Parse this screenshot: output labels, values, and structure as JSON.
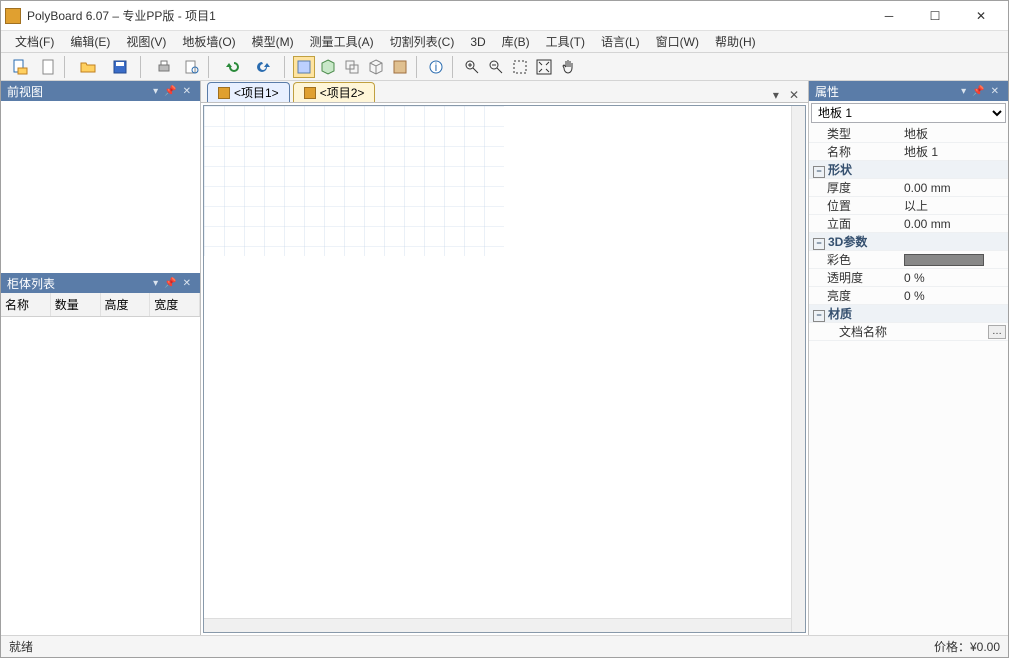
{
  "window": {
    "title": "PolyBoard 6.07 – 专业PP版 - 项目1"
  },
  "menu": {
    "file": "文档(F)",
    "edit": "编辑(E)",
    "view": "视图(V)",
    "floor": "地板墙(O)",
    "model": "模型(M)",
    "meas": "测量工具(A)",
    "cut": "切割列表(C)",
    "threeD": "3D",
    "lib": "库(B)",
    "tool": "工具(T)",
    "lang": "语言(L)",
    "win": "窗口(W)",
    "help": "帮助(H)"
  },
  "panels": {
    "frontview": "前视图",
    "cablist": "柜体列表",
    "props": "属性"
  },
  "cab_cols": {
    "name": "名称",
    "qty": "数量",
    "height": "高度",
    "width": "宽度"
  },
  "tabs": {
    "t1": "<项目1>",
    "t2": "<项目2>"
  },
  "props": {
    "selector": "地板 1",
    "type_k": "类型",
    "type_v": "地板",
    "name_k": "名称",
    "name_v": "地板 1",
    "shape_g": "形状",
    "thick_k": "厚度",
    "thick_v": "0.00 mm",
    "pos_k": "位置",
    "pos_v": "以上",
    "elev_k": "立面",
    "elev_v": "0.00 mm",
    "threeD_g": "3D参数",
    "color_k": "彩色",
    "trans_k": "透明度",
    "trans_v": "0 %",
    "bright_k": "亮度",
    "bright_v": "0 %",
    "mat_g": "材质",
    "docname_k": "文档名称",
    "docname_v": ""
  },
  "status": {
    "ready": "就绪",
    "price": "价格：¥0.00"
  }
}
